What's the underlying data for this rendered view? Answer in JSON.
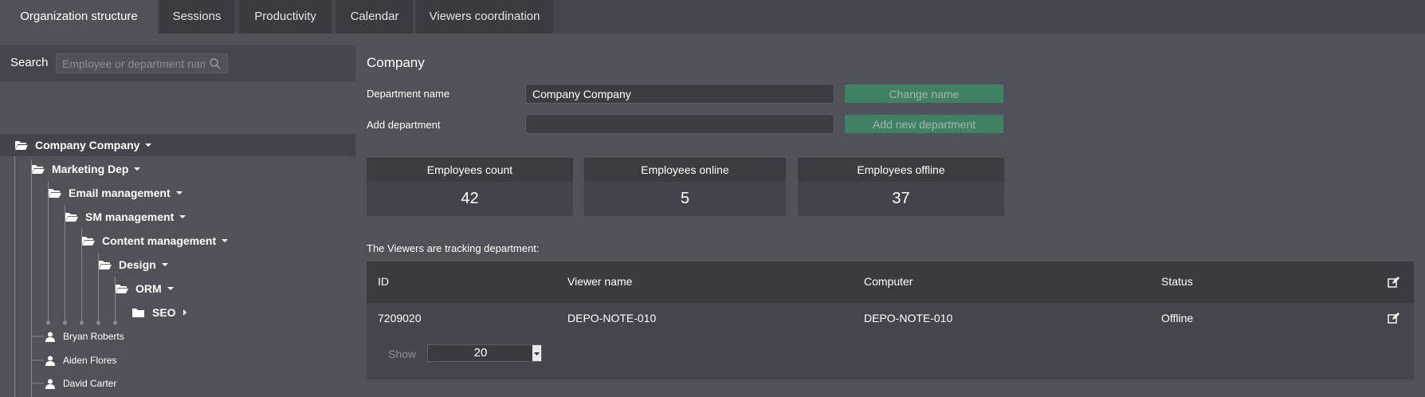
{
  "tabs": [
    {
      "label": "Organization structure",
      "active": true
    },
    {
      "label": "Sessions",
      "active": false
    },
    {
      "label": "Productivity",
      "active": false
    },
    {
      "label": "Calendar",
      "active": false
    },
    {
      "label": "Viewers coordination",
      "active": false
    }
  ],
  "search": {
    "label": "Search",
    "placeholder": "Employee or department name",
    "icon": "search-icon"
  },
  "tree": {
    "departments": [
      {
        "name": "Company Company",
        "level": 0,
        "expanded": true,
        "selected": true
      },
      {
        "name": "Marketing Dep",
        "level": 1,
        "expanded": true
      },
      {
        "name": "Email management",
        "level": 2,
        "expanded": true
      },
      {
        "name": "SM management",
        "level": 3,
        "expanded": true
      },
      {
        "name": "Content management",
        "level": 4,
        "expanded": true
      },
      {
        "name": "Design",
        "level": 5,
        "expanded": true
      },
      {
        "name": "ORM",
        "level": 6,
        "expanded": true
      },
      {
        "name": "SEO",
        "level": 7,
        "expanded": false
      }
    ],
    "employees": [
      "Bryan Roberts",
      "Aiden Flores",
      "David Carter"
    ]
  },
  "department": {
    "title": "Company",
    "name_label": "Department name",
    "name_value": "Company Company",
    "change_name_button": "Change name",
    "add_label": "Add department",
    "add_value": "",
    "add_button": "Add new department"
  },
  "stats": {
    "count_label": "Employees count",
    "count_value": "42",
    "online_label": "Employees online",
    "online_value": "5",
    "offline_label": "Employees offline",
    "offline_value": "37"
  },
  "viewers": {
    "caption": "The Viewers are tracking department:",
    "headers": {
      "id": "ID",
      "viewer": "Viewer name",
      "computer": "Computer",
      "status": "Status"
    },
    "rows": [
      {
        "id": "7209020",
        "viewer": "DEPO-NOTE-010",
        "computer": "DEPO-NOTE-010",
        "status": "Offline"
      }
    ],
    "show_label": "Show",
    "show_value": "20"
  },
  "colors": {
    "background": "#505159",
    "panel_dark": "#3a3b41",
    "accent_green": "#3f8163"
  }
}
